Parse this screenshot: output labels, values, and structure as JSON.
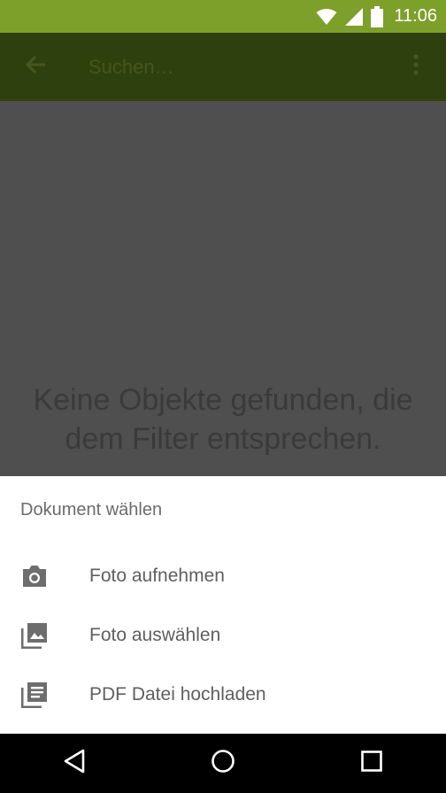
{
  "status_bar": {
    "time": "11:06",
    "icons": [
      "wifi-icon",
      "signal-icon",
      "battery-icon"
    ]
  },
  "toolbar": {
    "search_placeholder": "Suchen…",
    "icons": [
      "back-arrow-icon",
      "overflow-menu-icon"
    ]
  },
  "content": {
    "empty_message_line1": "Keine Objekte gefunden, die",
    "empty_message_line2": "dem Filter entsprechen."
  },
  "bottom_sheet": {
    "title": "Dokument wählen",
    "items": [
      {
        "label": "Foto aufnehmen",
        "icon": "camera-icon"
      },
      {
        "label": "Foto auswählen",
        "icon": "image-gallery-icon"
      },
      {
        "label": "PDF Datei hochladen",
        "icon": "document-list-icon"
      }
    ]
  },
  "nav_bar": {
    "icons": [
      "back-triangle-icon",
      "home-circle-icon",
      "recents-square-icon"
    ]
  },
  "colors": {
    "status_bar": "#7da02a",
    "toolbar": "#2e400d",
    "scrim": "#4f4f4f",
    "sheet": "#ffffff",
    "nav_bar": "#000000"
  }
}
